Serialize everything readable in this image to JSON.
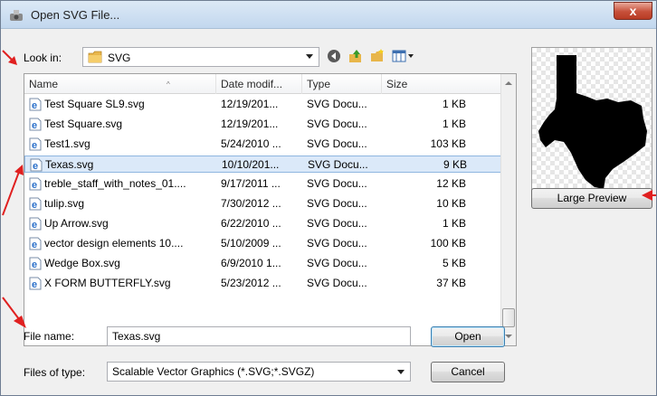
{
  "window": {
    "title": "Open SVG File...",
    "close_label": "x"
  },
  "lookin": {
    "label": "Look in:",
    "value": "SVG"
  },
  "toolbar": {
    "back_icon": "back-arrow-icon",
    "up_icon": "up-folder-icon",
    "new_folder_icon": "new-folder-icon",
    "views_icon": "views-menu-icon"
  },
  "columns": {
    "name": "Name",
    "date": "Date modif...",
    "type": "Type",
    "size": "Size"
  },
  "files": [
    {
      "name": "Test Square SL9.svg",
      "date": "12/19/201...",
      "type": "SVG Docu...",
      "size": "1 KB",
      "selected": false
    },
    {
      "name": "Test Square.svg",
      "date": "12/19/201...",
      "type": "SVG Docu...",
      "size": "1 KB",
      "selected": false
    },
    {
      "name": "Test1.svg",
      "date": "5/24/2010 ...",
      "type": "SVG Docu...",
      "size": "103 KB",
      "selected": false
    },
    {
      "name": "Texas.svg",
      "date": "10/10/201...",
      "type": "SVG Docu...",
      "size": "9 KB",
      "selected": true
    },
    {
      "name": "treble_staff_with_notes_01....",
      "date": "9/17/2011 ...",
      "type": "SVG Docu...",
      "size": "12 KB",
      "selected": false
    },
    {
      "name": "tulip.svg",
      "date": "7/30/2012 ...",
      "type": "SVG Docu...",
      "size": "10 KB",
      "selected": false
    },
    {
      "name": "Up Arrow.svg",
      "date": "6/22/2010 ...",
      "type": "SVG Docu...",
      "size": "1 KB",
      "selected": false
    },
    {
      "name": "vector design elements 10....",
      "date": "5/10/2009 ...",
      "type": "SVG Docu...",
      "size": "100 KB",
      "selected": false
    },
    {
      "name": "Wedge Box.svg",
      "date": "6/9/2010 1...",
      "type": "SVG Docu...",
      "size": "5 KB",
      "selected": false
    },
    {
      "name": "X FORM BUTTERFLY.svg",
      "date": "5/23/2012 ...",
      "type": "SVG Docu...",
      "size": "37 KB",
      "selected": false
    }
  ],
  "preview": {
    "button_label": "Large Preview"
  },
  "filename": {
    "label": "File name:",
    "value": "Texas.svg"
  },
  "filetype": {
    "label": "Files of type:",
    "value": "Scalable Vector Graphics (*.SVG;*.SVGZ)"
  },
  "buttons": {
    "open": "Open",
    "cancel": "Cancel"
  },
  "colors": {
    "annotation_arrow": "#e02020",
    "selection": "#dbe9f9"
  }
}
